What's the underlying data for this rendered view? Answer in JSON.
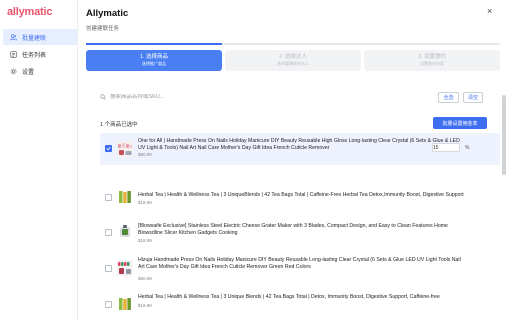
{
  "app": {
    "logo": "allymatic",
    "title": "Allymatic",
    "subtitle": "创建建联任务",
    "close_label": "×"
  },
  "sidebar": {
    "items": [
      {
        "label": "批量建联",
        "icon": "users-icon",
        "active": true
      },
      {
        "label": "任务列表",
        "icon": "list-icon",
        "active": false
      },
      {
        "label": "设置",
        "icon": "gear-icon",
        "active": false
      }
    ]
  },
  "steps": [
    {
      "title": "1. 选择商品",
      "desc": "选择推广商品",
      "active": true
    },
    {
      "title": "2. 选择达人",
      "desc": "选择要建联的达人",
      "active": false
    },
    {
      "title": "3. 设置邀约",
      "desc": "设置邀约内容",
      "active": false
    }
  ],
  "search": {
    "placeholder": "搜索商品名称或SKU...",
    "value": ""
  },
  "actions": {
    "select_all": "全选",
    "clear": "清空",
    "batch_commission": "批量设置佣金率"
  },
  "selection": {
    "count_text": "1 个商品已选中"
  },
  "products": [
    {
      "title": "One for All | Handmade Press On Nails Holiday Manicure DIY Beauty Reusable High Gloss Long-lasting Clear Crystal (6 Sets & Glue & LED UV Light & Tools) Nail Art Nail Care Mother's Day Gift Idea French Cuticle Remover",
      "price": "$60.99",
      "selected": true,
      "commission": "15",
      "unit": "%"
    },
    {
      "title": "Herbal Tea | Health & Wellness Tea | 3 UniqueBlends | 42 Tea Bags Total | Caffeine-Free Herbal Tea Detox,Immunity Boost, Digestive Support",
      "price": "$19.99",
      "selected": false
    },
    {
      "title": "[Blowsaife Exclusive] Stainless Steel Electric Cheese Grater Maker with 3 Blades, Compact Design, and Easy to Clean Features Home Blowsdline Slicer Kitchen Gadgets Cooking",
      "price": "$18.99",
      "selected": false
    },
    {
      "title": "Hizuja Handmade Press On Nails Holiday Manicure DIY Beauty Reusable Long-lasting Clear Crystal (6 Sets & Glue LED UV Light Tools Nail Art Care Mother's Day Gift Idea French Cuticle Remover Green Red Colors",
      "price": "$60.99",
      "selected": false
    },
    {
      "title": "Herbal Tea | Health & Wellness Tea | 3 Unique Blends | 42 Tea Bags Total | Detox, Immunity Boost, Digestive Support, Caffeine-free",
      "price": "$19.99",
      "selected": false
    }
  ],
  "colors": {
    "accent": "#3d6ef0",
    "brand": "#e8556e",
    "selected_row": "#eef3ff"
  }
}
